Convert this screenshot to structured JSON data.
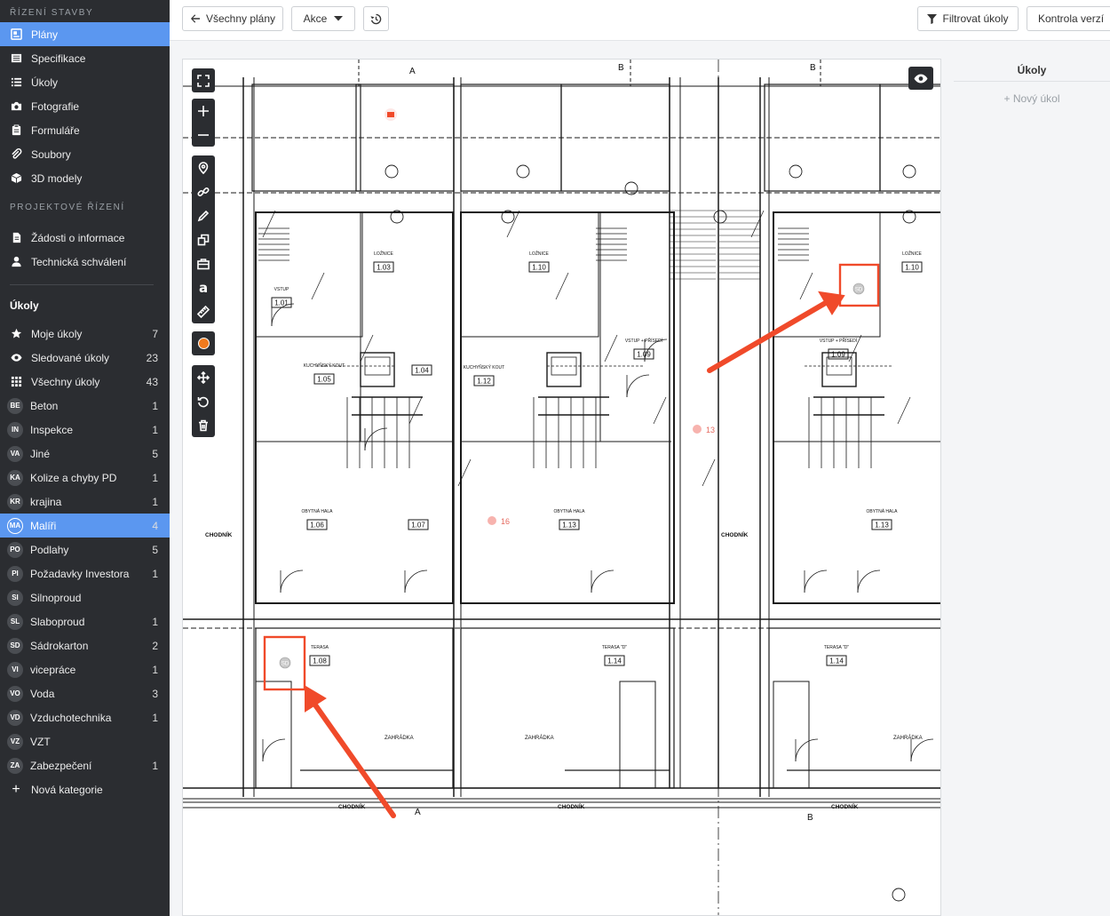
{
  "sidebar": {
    "section1": "ŘÍZENÍ STAVBY",
    "nav": [
      {
        "label": "Plány",
        "icon": "plans-icon",
        "active": true
      },
      {
        "label": "Specifikace",
        "icon": "specification-icon"
      },
      {
        "label": "Úkoly",
        "icon": "list-icon"
      },
      {
        "label": "Fotografie",
        "icon": "camera-icon"
      },
      {
        "label": "Formuláře",
        "icon": "clipboard-icon"
      },
      {
        "label": "Soubory",
        "icon": "paperclip-icon"
      },
      {
        "label": "3D modely",
        "icon": "cube-icon"
      }
    ],
    "section2": "PROJEKTOVÉ ŘÍZENÍ",
    "nav2": [
      {
        "label": "Žádosti o informace",
        "icon": "document-icon"
      },
      {
        "label": "Technická schválení",
        "icon": "person-icon"
      }
    ],
    "tasks_heading": "Úkoly",
    "task_filters": [
      {
        "label": "Moje úkoly",
        "count": "7",
        "icon": "star-icon"
      },
      {
        "label": "Sledované úkoly",
        "count": "23",
        "icon": "eye-icon"
      },
      {
        "label": "Všechny úkoly",
        "count": "43",
        "icon": "grid-icon"
      }
    ],
    "categories": [
      {
        "badge": "BE",
        "label": "Beton",
        "count": "1"
      },
      {
        "badge": "IN",
        "label": "Inspekce",
        "count": "1"
      },
      {
        "badge": "VA",
        "label": "Jiné",
        "count": "5"
      },
      {
        "badge": "KA",
        "label": "Kolize a chyby PD",
        "count": "1"
      },
      {
        "badge": "KR",
        "label": "krajina",
        "count": "1"
      },
      {
        "badge": "MA",
        "label": "Malíři",
        "count": "4",
        "active": true
      },
      {
        "badge": "PO",
        "label": "Podlahy",
        "count": "5"
      },
      {
        "badge": "PI",
        "label": "Požadavky Investora",
        "count": "1"
      },
      {
        "badge": "SI",
        "label": "Silnoproud",
        "count": ""
      },
      {
        "badge": "SL",
        "label": "Slaboproud",
        "count": "1"
      },
      {
        "badge": "SD",
        "label": "Sádrokarton",
        "count": "2"
      },
      {
        "badge": "VI",
        "label": "vicepráce",
        "count": "1"
      },
      {
        "badge": "VO",
        "label": "Voda",
        "count": "3"
      },
      {
        "badge": "VD",
        "label": "Vzduchotechnika",
        "count": "1"
      },
      {
        "badge": "VZ",
        "label": "VZT",
        "count": ""
      },
      {
        "badge": "ZA",
        "label": "Zabezpečení",
        "count": "1"
      }
    ],
    "new_category": "Nová kategorie"
  },
  "toolbar": {
    "all_plans": "Všechny plány",
    "actions": "Akce",
    "filter_tasks": "Filtrovat úkoly",
    "version_control": "Kontrola verzí"
  },
  "tasks_panel": {
    "title": "Úkoly",
    "new_task": "+ Nový úkol"
  },
  "plan": {
    "rooms": [
      {
        "code": "1.03",
        "name": "LOŽNICE"
      },
      {
        "code": "1.10",
        "name": "LOŽNICE"
      },
      {
        "code": "1.10",
        "name": "LOŽNICE"
      },
      {
        "code": "1.01",
        "name": "VSTUP"
      },
      {
        "code": "1.04",
        "name": ""
      },
      {
        "code": "1.05",
        "name": "KUCHYŇSKÝ KOUT"
      },
      {
        "code": "1.12",
        "name": "KUCHYŇSKÝ KOUT"
      },
      {
        "code": "1.09",
        "name": "VSTUP + PŘÍSEDÍ"
      },
      {
        "code": "1.09",
        "name": "VSTUP + PŘÍSEDÍ"
      },
      {
        "code": "1.06",
        "name": "OBYTNÁ HALA"
      },
      {
        "code": "1.07",
        "name": ""
      },
      {
        "code": "1.13",
        "name": "OBYTNÁ HALA"
      },
      {
        "code": "1.13",
        "name": "OBYTNÁ HALA"
      },
      {
        "code": "1.08",
        "name": "TERASA"
      },
      {
        "code": "1.14",
        "name": "TERASA \"D\""
      },
      {
        "code": "1.14",
        "name": "TERASA \"D\""
      }
    ],
    "labels": {
      "walkway": "CHODNÍK",
      "garden": "ZAHRÁDKA",
      "section_a": "A",
      "section_b": "B"
    },
    "markers": [
      {
        "number": "13"
      },
      {
        "number": "16"
      }
    ],
    "marker_badges": [
      "SD",
      "SD"
    ],
    "accent": "#f04a2a"
  }
}
